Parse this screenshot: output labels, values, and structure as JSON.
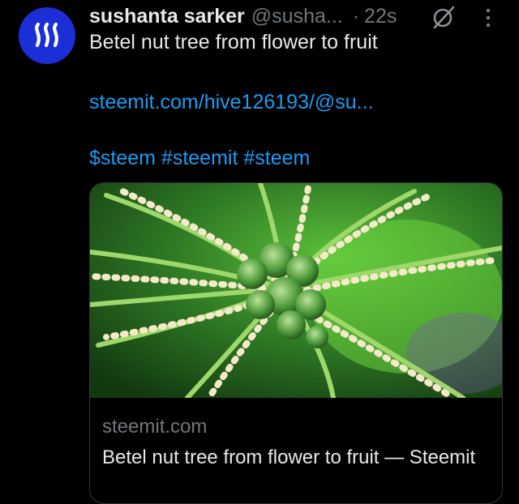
{
  "post": {
    "author_name": "sushanta sarker",
    "author_handle": "@susha...",
    "separator": "·",
    "timestamp": "22s",
    "text": "Betel nut tree from flower to fruit",
    "link_text": "steemit.com/hive126193/@su...",
    "hashtags": "$steem #steemit #steem"
  },
  "card": {
    "domain": "steemit.com",
    "title": "Betel nut tree from flower to fruit — Steemit",
    "image_name": "betel-nut-flower-photo"
  },
  "icons": {
    "avatar": "steem-logo-icon",
    "grok": "grok-icon",
    "more": "more-vertical-icon"
  },
  "colors": {
    "background": "#000000",
    "text": "#e7e9ea",
    "muted": "#71767b",
    "link": "#1d9bf0",
    "avatar_bg": "#1c2fd6"
  }
}
